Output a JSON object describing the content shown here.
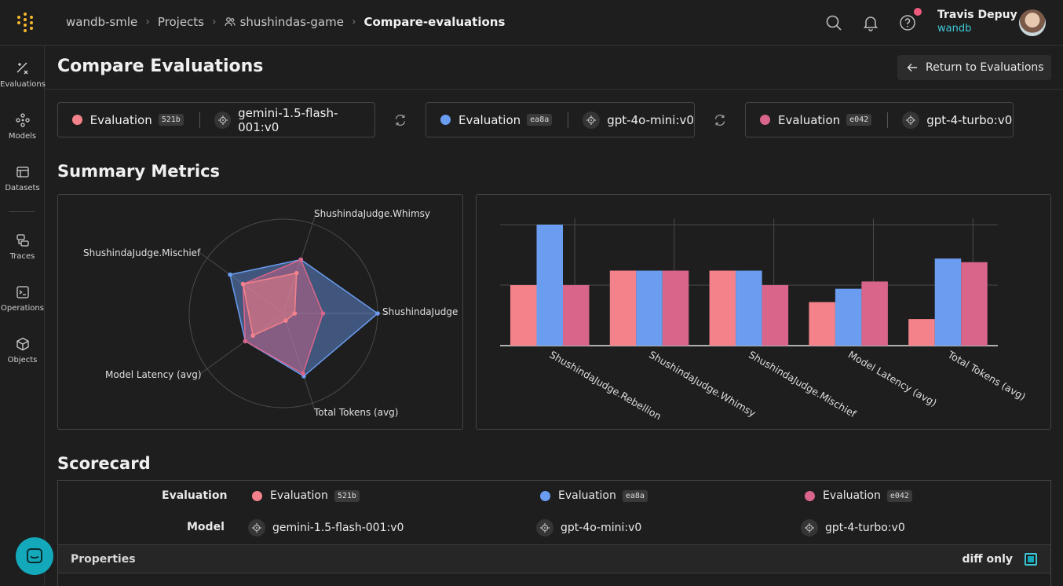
{
  "breadcrumb": {
    "org": "wandb-smle",
    "projects": "Projects",
    "project": "shushindas-game",
    "current": "Compare-evaluations"
  },
  "user": {
    "name": "Travis Depuy",
    "org": "wandb"
  },
  "sidebar": {
    "items": [
      {
        "label": "Evaluations",
        "icon": "evaluations-icon"
      },
      {
        "label": "Models",
        "icon": "models-icon"
      },
      {
        "label": "Datasets",
        "icon": "datasets-icon"
      },
      {
        "label": "Traces",
        "icon": "traces-icon"
      },
      {
        "label": "Operations",
        "icon": "operations-icon"
      },
      {
        "label": "Objects",
        "icon": "objects-icon"
      }
    ]
  },
  "page": {
    "title": "Compare Evaluations",
    "return_label": "Return to Evaluations"
  },
  "evaluations": [
    {
      "label": "Evaluation",
      "id": "521b",
      "model": "gemini-1.5-flash-001:v0",
      "color": "#f4828a"
    },
    {
      "label": "Evaluation",
      "id": "ea8a",
      "model": "gpt-4o-mini:v0",
      "color": "#6a9cf0"
    },
    {
      "label": "Evaluation",
      "id": "e042",
      "model": "gpt-4-turbo:v0",
      "color": "#d9668a"
    }
  ],
  "summary": {
    "title": "Summary Metrics"
  },
  "chart_data": [
    {
      "type": "radar",
      "axes": [
        "ShushindaJudge.Whimsy",
        "ShushindaJudge",
        "Total Tokens (avg)",
        "Model Latency (avg)",
        "ShushindaJudge.Mischief"
      ],
      "series": [
        {
          "values": [
            0.45,
            0.12,
            0.08,
            0.4,
            0.53
          ]
        },
        {
          "values": [
            0.6,
            1.0,
            0.7,
            0.5,
            0.7
          ]
        },
        {
          "values": [
            0.6,
            0.42,
            0.67,
            0.5,
            0.53
          ]
        }
      ]
    },
    {
      "type": "bar",
      "categories": [
        "ShushindaJudge.Rebellion",
        "ShushindaJudge.Whimsy",
        "ShushindaJudge.Mischief",
        "Model Latency (avg)",
        "Total Tokens (avg)"
      ],
      "series": [
        {
          "values": [
            0.5,
            0.62,
            0.62,
            0.36,
            0.22
          ]
        },
        {
          "values": [
            1.0,
            0.62,
            0.62,
            0.47,
            0.72
          ]
        },
        {
          "values": [
            0.5,
            0.62,
            0.5,
            0.53,
            0.69
          ]
        }
      ],
      "ylim": [
        0,
        1
      ]
    }
  ],
  "scorecard": {
    "title": "Scorecard",
    "evaluation_label": "Evaluation",
    "model_label": "Model",
    "properties_label": "Properties",
    "diff_only_label": "diff only",
    "diff_only": true
  }
}
